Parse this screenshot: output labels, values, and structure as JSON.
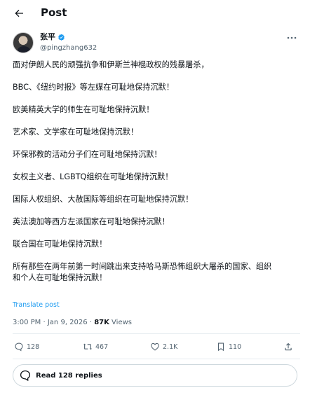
{
  "header": {
    "title": "Post"
  },
  "author": {
    "name": "张平",
    "handle": "@pingzhang632"
  },
  "post": {
    "paragraphs": [
      "面对伊朗人民的顽强抗争和伊斯兰神棍政权的残暴屠杀，",
      "BBC、《纽约时报》等左媒在可耻地保持沉默！",
      "欧美精英大学的师生在可耻地保持沉默！",
      "艺术家、文学家在可耻地保持沉默！",
      "环保邪教的活动分子们在可耻地保持沉默！",
      "女权主义者、LGBTQ组织在可耻地保持沉默！",
      "国际人权组织、大赦国际等组织在可耻地保持沉默！",
      "英法澳加等西方左派国家在可耻地保持沉默！",
      "联合国在可耻地保持沉默！",
      "所有那些在两年前第一时间跳出来支持哈马斯恐怖组织大屠杀的国家、组织\n和个人在可耻地保持沉默！"
    ],
    "translate_label": "Translate post"
  },
  "meta": {
    "time": "3:00 PM",
    "separator": "·",
    "date": "Jan 9, 2026",
    "views_count": "87K",
    "views_label": "Views"
  },
  "actions": {
    "replies": "128",
    "reposts": "467",
    "likes": "2.1K",
    "bookmarks": "110"
  },
  "read_replies_label": "Read 128 replies",
  "colors": {
    "link": "#1d9bf0",
    "verified": "#1d9bf0",
    "muted": "#536471"
  },
  "icons": [
    "back-arrow-icon",
    "verified-badge-icon",
    "more-icon",
    "reply-icon",
    "repost-icon",
    "like-icon",
    "bookmark-icon",
    "share-icon",
    "chat-bubble-icon"
  ]
}
